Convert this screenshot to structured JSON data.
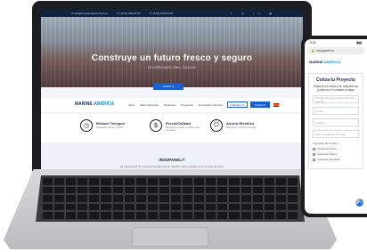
{
  "topbar": {
    "email": "✉ info@insupanelamerica.com",
    "phone1": "✆ +57(1) 000 00 00",
    "phone2": "✆ +57(1) 000 00 00",
    "social": "f ◎ in ▶"
  },
  "hero": {
    "title": "Construye un futuro fresco y seguro",
    "subtitle": "DIVÓRCIATE DEL CALOR",
    "button": "Cotizar ➔"
  },
  "brand": {
    "name": "MARINE",
    "accent": " AMÉRICA"
  },
  "nav": {
    "links": [
      "Inicio",
      "Sobre Nosotros",
      "Productos",
      "Proyectos",
      "Información Técnica"
    ],
    "select": "Catálogos ▾",
    "cta": "Cotizar ▾"
  },
  "features": [
    {
      "title": "Reduce Tiempos",
      "desc": "Instalación rápida y segura",
      "icon": "clock-icon",
      "glyph": "◷"
    },
    {
      "title": "Precio/Calidad",
      "desc": "Rehúsa ser simple, es ahorro para el cuidado",
      "icon": "price-tag-icon",
      "glyph": "$"
    },
    {
      "title": "Ahorro Eléctrico",
      "desc": "Disminuye el costo de energía",
      "icon": "plug-icon",
      "glyph": "⏻"
    }
  ],
  "insupanel": {
    "title": "INSUPANEL®",
    "desc": "La ingeniería® de nuestro Insupanel es la solución para el aislamiento térmico acústico"
  },
  "phone": {
    "time": "9:41",
    "signal": "▮▮▮",
    "url": "insupanel.co",
    "logo": "MARINE",
    "logo_accent": " AMÉRICA",
    "card_title": "Cotiza tu Proyecto",
    "card_desc": "Déjanos tus datos y en seguida nos ponemos en contacto contigo",
    "fields": [
      "Nombre de la empresa / persona natural",
      "Correo",
      "Teléfono",
      "País y ciudad de entrega"
    ],
    "checks_label": "Insupanel de interés *",
    "checks": [
      "Insupanel Techo",
      "Insupanel Pared",
      "Insupanel Fachada"
    ]
  }
}
